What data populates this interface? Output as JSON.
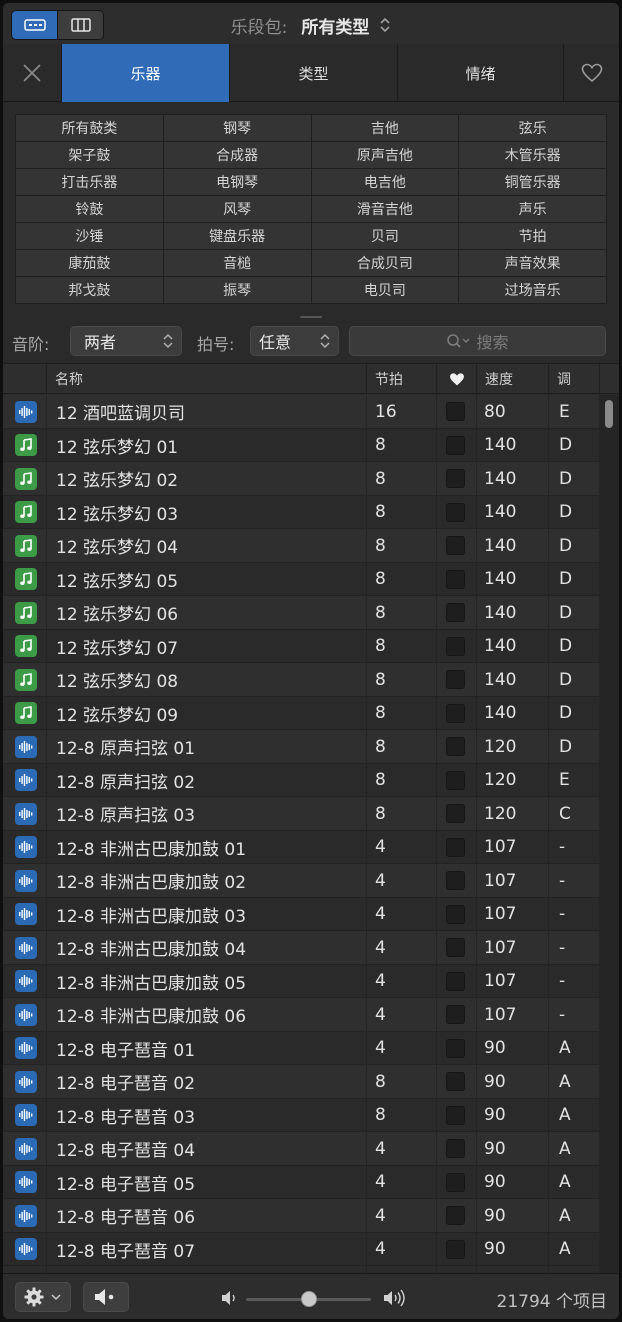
{
  "header": {
    "label": "乐段包:",
    "value": "所有类型",
    "chevron": "⌃⌄"
  },
  "tabs": [
    {
      "label": "乐器",
      "active": true
    },
    {
      "label": "类型",
      "active": false
    },
    {
      "label": "情绪",
      "active": false
    }
  ],
  "keywords": [
    "所有鼓类",
    "钢琴",
    "吉他",
    "弦乐",
    "架子鼓",
    "合成器",
    "原声吉他",
    "木管乐器",
    "打击乐器",
    "电钢琴",
    "电吉他",
    "铜管乐器",
    "铃鼓",
    "风琴",
    "滑音吉他",
    "声乐",
    "沙锤",
    "键盘乐器",
    "贝司",
    "节拍",
    "康茄鼓",
    "音槌",
    "合成贝司",
    "声音效果",
    "邦戈鼓",
    "振琴",
    "电贝司",
    "过场音乐"
  ],
  "filters": {
    "scale_label": "音阶:",
    "scale_value": "两者",
    "time_sig_label": "拍号:",
    "time_sig_value": "任意",
    "search_placeholder": "搜索"
  },
  "columns": {
    "name": "名称",
    "beats": "节拍",
    "tempo": "速度",
    "key": "调"
  },
  "rows": [
    {
      "type": "audio",
      "name": "12 酒吧蓝调贝司",
      "beats": "16",
      "tempo": "80",
      "key": "E"
    },
    {
      "type": "midi",
      "name": "12 弦乐梦幻 01",
      "beats": "8",
      "tempo": "140",
      "key": "D"
    },
    {
      "type": "midi",
      "name": "12 弦乐梦幻 02",
      "beats": "8",
      "tempo": "140",
      "key": "D"
    },
    {
      "type": "midi",
      "name": "12 弦乐梦幻 03",
      "beats": "8",
      "tempo": "140",
      "key": "D"
    },
    {
      "type": "midi",
      "name": "12 弦乐梦幻 04",
      "beats": "8",
      "tempo": "140",
      "key": "D"
    },
    {
      "type": "midi",
      "name": "12 弦乐梦幻 05",
      "beats": "8",
      "tempo": "140",
      "key": "D"
    },
    {
      "type": "midi",
      "name": "12 弦乐梦幻 06",
      "beats": "8",
      "tempo": "140",
      "key": "D"
    },
    {
      "type": "midi",
      "name": "12 弦乐梦幻 07",
      "beats": "8",
      "tempo": "140",
      "key": "D"
    },
    {
      "type": "midi",
      "name": "12 弦乐梦幻 08",
      "beats": "8",
      "tempo": "140",
      "key": "D"
    },
    {
      "type": "midi",
      "name": "12 弦乐梦幻 09",
      "beats": "8",
      "tempo": "140",
      "key": "D"
    },
    {
      "type": "audio",
      "name": "12-8 原声扫弦 01",
      "beats": "8",
      "tempo": "120",
      "key": "D"
    },
    {
      "type": "audio",
      "name": "12-8 原声扫弦 02",
      "beats": "8",
      "tempo": "120",
      "key": "E"
    },
    {
      "type": "audio",
      "name": "12-8 原声扫弦 03",
      "beats": "8",
      "tempo": "120",
      "key": "C"
    },
    {
      "type": "audio",
      "name": "12-8 非洲古巴康加鼓 01",
      "beats": "4",
      "tempo": "107",
      "key": "-"
    },
    {
      "type": "audio",
      "name": "12-8 非洲古巴康加鼓 02",
      "beats": "4",
      "tempo": "107",
      "key": "-"
    },
    {
      "type": "audio",
      "name": "12-8 非洲古巴康加鼓 03",
      "beats": "4",
      "tempo": "107",
      "key": "-"
    },
    {
      "type": "audio",
      "name": "12-8 非洲古巴康加鼓 04",
      "beats": "4",
      "tempo": "107",
      "key": "-"
    },
    {
      "type": "audio",
      "name": "12-8 非洲古巴康加鼓 05",
      "beats": "4",
      "tempo": "107",
      "key": "-"
    },
    {
      "type": "audio",
      "name": "12-8 非洲古巴康加鼓 06",
      "beats": "4",
      "tempo": "107",
      "key": "-"
    },
    {
      "type": "audio",
      "name": "12-8 电子琶音 01",
      "beats": "4",
      "tempo": "90",
      "key": "A"
    },
    {
      "type": "audio",
      "name": "12-8 电子琶音 02",
      "beats": "8",
      "tempo": "90",
      "key": "A"
    },
    {
      "type": "audio",
      "name": "12-8 电子琶音 03",
      "beats": "8",
      "tempo": "90",
      "key": "A"
    },
    {
      "type": "audio",
      "name": "12-8 电子琶音 04",
      "beats": "4",
      "tempo": "90",
      "key": "A"
    },
    {
      "type": "audio",
      "name": "12-8 电子琶音 05",
      "beats": "4",
      "tempo": "90",
      "key": "A"
    },
    {
      "type": "audio",
      "name": "12-8 电子琶音 06",
      "beats": "4",
      "tempo": "90",
      "key": "A"
    },
    {
      "type": "audio",
      "name": "12-8 电子琶音 07",
      "beats": "4",
      "tempo": "90",
      "key": "A"
    }
  ],
  "footer": {
    "volume_level": 0.5,
    "count_text": "21794 个项目"
  },
  "colors": {
    "accent": "#2f6bb6",
    "audio_icon": "#2b6ab5",
    "midi_icon": "#3d9a47",
    "panel": "#2a2a2a"
  },
  "icons": {
    "view_mode_list": "list-view-icon",
    "view_mode_columns": "column-view-icon",
    "close": "close-icon",
    "favorite": "heart-icon",
    "search": "search-icon",
    "settings": "gear-icon",
    "preview": "speaker-icon"
  }
}
